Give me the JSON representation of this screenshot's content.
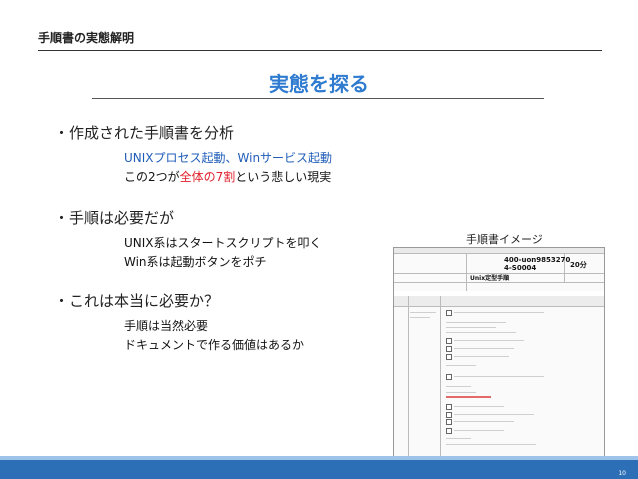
{
  "header": {
    "title": "手順書の実態解明"
  },
  "slide": {
    "title": "実態を探る"
  },
  "bullets": [
    {
      "heading": "・作成された手順書を分析",
      "line1": "UNIXプロセス起動、Winサービス起動",
      "line2_pre": "この2つが",
      "line2_highlight": "全体の7割",
      "line2_post": "という悲しい現実"
    },
    {
      "heading": "・手順は必要だが",
      "line1": "UNIX系はスタートスクリプトを叩く",
      "line2": "Win系は起動ボタンをポチ"
    },
    {
      "heading": "・これは本当に必要か？",
      "line1": "手順は当然必要",
      "line2": "ドキュメントで作る価値はあるか"
    }
  ],
  "image": {
    "caption": "手順書イメージ",
    "doc_id": "400-uon9853270",
    "doc_id2": "4-S0004",
    "duration": "20分",
    "doc_title": "Unix定型手順"
  },
  "footer": {
    "page": "10"
  },
  "colors": {
    "accent": "#2f7bd0",
    "highlight": "#e0202a",
    "bar": "#2d6fb7"
  }
}
